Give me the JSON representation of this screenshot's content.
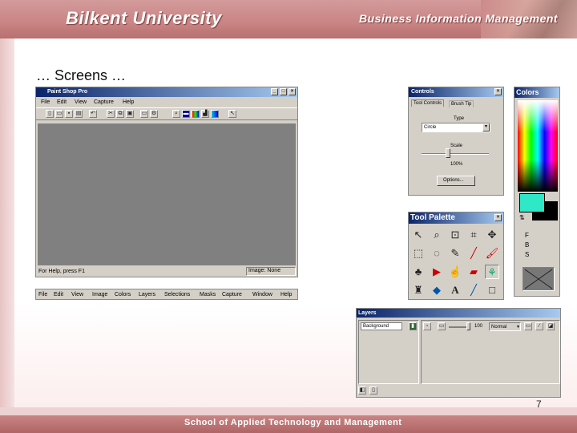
{
  "header": {
    "university": "Bilkent University",
    "program": "Business Information Management"
  },
  "footer": {
    "school": "School of Applied Technology and Management"
  },
  "slide": {
    "title": "… Screens …",
    "page_number": "7"
  },
  "psp_window": {
    "title": "Paint Shop Pro",
    "menu": [
      "File",
      "Edit",
      "View",
      "Capture",
      "Help"
    ],
    "status_left": "For Help, press F1",
    "status_right_label": "Image:",
    "status_right_value": "None"
  },
  "full_menu": [
    "File",
    "Edit",
    "View",
    "Image",
    "Colors",
    "Layers",
    "Selections",
    "Masks",
    "Capture",
    "Window",
    "Help"
  ],
  "controls": {
    "title": "Controls",
    "tabs": [
      "Tool Controls",
      "Brush Tip"
    ],
    "type_label": "Type",
    "type_value": "Circle",
    "scale_label": "Scale",
    "scale_value": "100%",
    "options_label": "Options..."
  },
  "colors_panel": {
    "title": "Colors",
    "fg_letter": "F",
    "bg_letter": "B",
    "stroke_letter": "S"
  },
  "tool_palette": {
    "title": "Tool Palette"
  },
  "layers": {
    "title": "Layers",
    "row_label": "Background",
    "opacity": "100",
    "mode": "Normal",
    "icons": [
      "eye-icon",
      "lock-icon",
      "new-layer-icon",
      "delete-layer-icon"
    ]
  },
  "colors": {
    "header": "#c98484",
    "titlebar": "#0a246a",
    "foreground": "#2ee8c8",
    "background": "#000000"
  }
}
